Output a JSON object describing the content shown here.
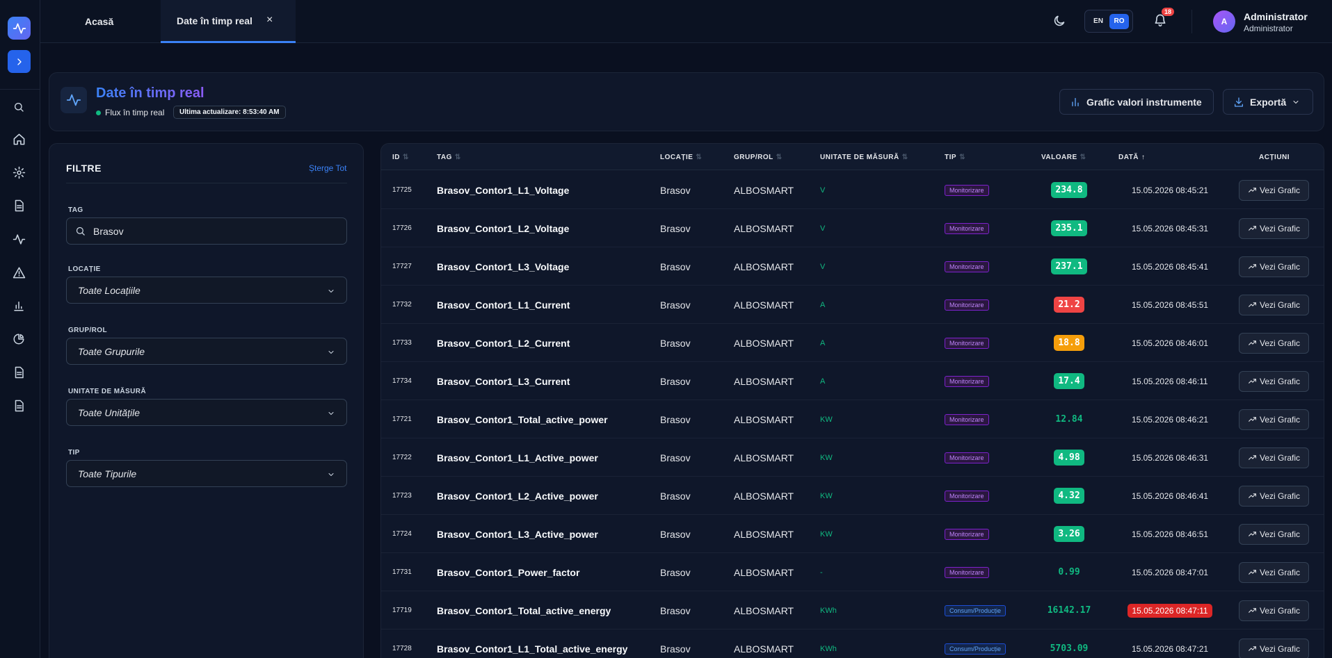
{
  "topbar": {
    "tabs": [
      {
        "label": "Acasă"
      },
      {
        "label": "Date în timp real",
        "close": "×"
      }
    ],
    "lang": {
      "en": "EN",
      "ro": "RO"
    },
    "notifications_count": "18",
    "user": {
      "initial": "A",
      "name": "Administrator",
      "role": "Administrator"
    }
  },
  "header": {
    "title": "Date în timp real",
    "live_label": "Flux în timp real",
    "updated": "Ultima actualizare: 8:53:40 AM",
    "chart_button": "Grafic valori instrumente",
    "export_button": "Exportă"
  },
  "filters": {
    "title": "FILTRE",
    "clear": "Șterge Tot",
    "tag_label": "TAG",
    "tag_value": "Brasov",
    "location_label": "LOCAȚIE",
    "location_value": "Toate Locațiile",
    "group_label": "GRUP/ROL",
    "group_value": "Toate Grupurile",
    "unit_label": "UNITATE DE MĂSURĂ",
    "unit_value": "Toate Unitățile",
    "type_label": "TIP",
    "type_value": "Toate Tipurile"
  },
  "table": {
    "headers": {
      "id": "ID",
      "tag": "TAG",
      "location": "LOCAȚIE",
      "group": "GRUP/ROL",
      "unit": "UNITATE DE MĂSURĂ",
      "type": "TIP",
      "value": "VALOARE",
      "date": "DATĂ",
      "actions": "ACȚIUNI"
    },
    "action_label": "Vezi Grafic",
    "rows": [
      {
        "id": "17725",
        "tag": "Brasov_Contor1_L1_Voltage",
        "location": "Brasov",
        "group": "ALBOSMART",
        "unit": "V",
        "type": "Monitorizare",
        "value": "234.8",
        "value_style": "green",
        "date": "15.05.2026 08:45:21",
        "date_late": false
      },
      {
        "id": "17726",
        "tag": "Brasov_Contor1_L2_Voltage",
        "location": "Brasov",
        "group": "ALBOSMART",
        "unit": "V",
        "type": "Monitorizare",
        "value": "235.1",
        "value_style": "green",
        "date": "15.05.2026 08:45:31",
        "date_late": false
      },
      {
        "id": "17727",
        "tag": "Brasov_Contor1_L3_Voltage",
        "location": "Brasov",
        "group": "ALBOSMART",
        "unit": "V",
        "type": "Monitorizare",
        "value": "237.1",
        "value_style": "green",
        "date": "15.05.2026 08:45:41",
        "date_late": false
      },
      {
        "id": "17732",
        "tag": "Brasov_Contor1_L1_Current",
        "location": "Brasov",
        "group": "ALBOSMART",
        "unit": "A",
        "type": "Monitorizare",
        "value": "21.2",
        "value_style": "red",
        "date": "15.05.2026 08:45:51",
        "date_late": false
      },
      {
        "id": "17733",
        "tag": "Brasov_Contor1_L2_Current",
        "location": "Brasov",
        "group": "ALBOSMART",
        "unit": "A",
        "type": "Monitorizare",
        "value": "18.8",
        "value_style": "orange",
        "date": "15.05.2026 08:46:01",
        "date_late": false
      },
      {
        "id": "17734",
        "tag": "Brasov_Contor1_L3_Current",
        "location": "Brasov",
        "group": "ALBOSMART",
        "unit": "A",
        "type": "Monitorizare",
        "value": "17.4",
        "value_style": "green",
        "date": "15.05.2026 08:46:11",
        "date_late": false
      },
      {
        "id": "17721",
        "tag": "Brasov_Contor1_Total_active_power",
        "location": "Brasov",
        "group": "ALBOSMART",
        "unit": "KW",
        "type": "Monitorizare",
        "value": "12.84",
        "value_style": "plain",
        "date": "15.05.2026 08:46:21",
        "date_late": false
      },
      {
        "id": "17722",
        "tag": "Brasov_Contor1_L1_Active_power",
        "location": "Brasov",
        "group": "ALBOSMART",
        "unit": "KW",
        "type": "Monitorizare",
        "value": "4.98",
        "value_style": "green",
        "date": "15.05.2026 08:46:31",
        "date_late": false
      },
      {
        "id": "17723",
        "tag": "Brasov_Contor1_L2_Active_power",
        "location": "Brasov",
        "group": "ALBOSMART",
        "unit": "KW",
        "type": "Monitorizare",
        "value": "4.32",
        "value_style": "green",
        "date": "15.05.2026 08:46:41",
        "date_late": false
      },
      {
        "id": "17724",
        "tag": "Brasov_Contor1_L3_Active_power",
        "location": "Brasov",
        "group": "ALBOSMART",
        "unit": "KW",
        "type": "Monitorizare",
        "value": "3.26",
        "value_style": "green",
        "date": "15.05.2026 08:46:51",
        "date_late": false
      },
      {
        "id": "17731",
        "tag": "Brasov_Contor1_Power_factor",
        "location": "Brasov",
        "group": "ALBOSMART",
        "unit": "-",
        "type": "Monitorizare",
        "value": "0.99",
        "value_style": "plain",
        "date": "15.05.2026 08:47:01",
        "date_late": false
      },
      {
        "id": "17719",
        "tag": "Brasov_Contor1_Total_active_energy",
        "location": "Brasov",
        "group": "ALBOSMART",
        "unit": "KWh",
        "type": "Consum/Producție",
        "value": "16142.17",
        "value_style": "plain",
        "date": "15.05.2026 08:47:11",
        "date_late": true
      },
      {
        "id": "17728",
        "tag": "Brasov_Contor1_L1_Total_active_energy",
        "location": "Brasov",
        "group": "ALBOSMART",
        "unit": "KWh",
        "type": "Consum/Producție",
        "value": "5703.09",
        "value_style": "plain",
        "date": "15.05.2026 08:47:21",
        "date_late": false
      }
    ]
  }
}
